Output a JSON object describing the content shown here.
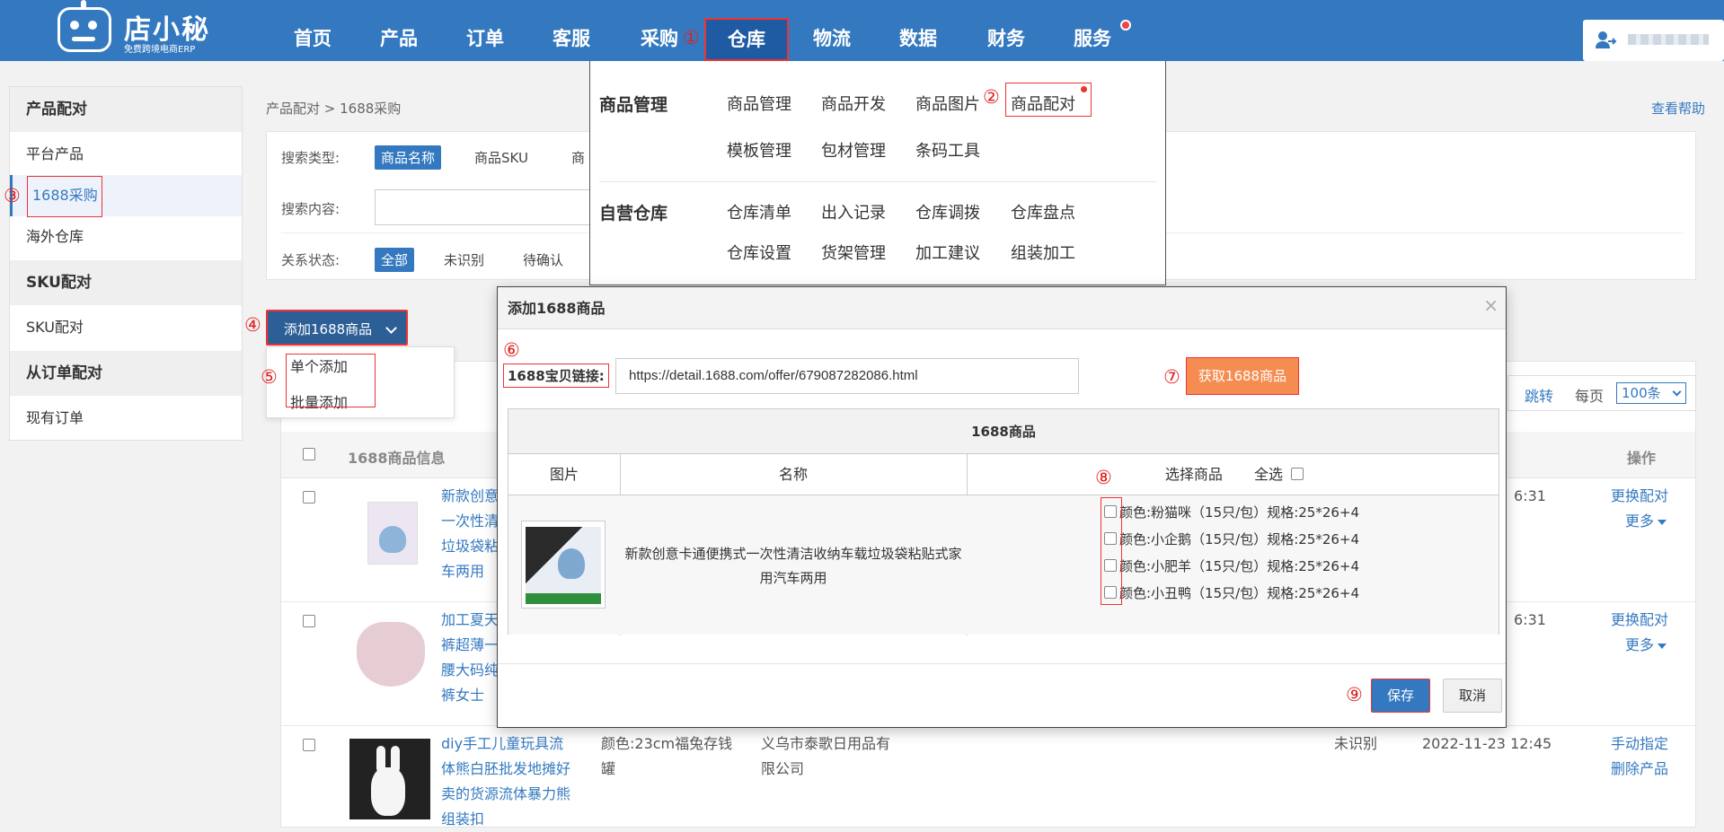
{
  "header": {
    "logo_name": "店小秘",
    "logo_sub": "免费跨境电商ERP",
    "nav": [
      "首页",
      "产品",
      "订单",
      "客服",
      "采购",
      "仓库",
      "物流",
      "数据",
      "财务",
      "服务"
    ],
    "active_nav": "仓库"
  },
  "annotations": [
    "①",
    "②",
    "③",
    "④",
    "⑤",
    "⑥",
    "⑦",
    "⑧",
    "⑨"
  ],
  "sidebar": {
    "sections": [
      {
        "title": "产品配对",
        "items": [
          "平台产品",
          "1688采购",
          "海外仓库"
        ]
      },
      {
        "title": "SKU配对",
        "items": [
          "SKU配对"
        ]
      },
      {
        "title": "从订单配对",
        "items": [
          "现有订单"
        ]
      }
    ],
    "active_item": "1688采购"
  },
  "breadcrumb": "产品配对 > 1688采购",
  "help_link": "查看帮助",
  "filter": {
    "search_type_label": "搜索类型:",
    "search_types": [
      "商品名称",
      "商品SKU",
      "商"
    ],
    "search_content_label": "搜索内容:",
    "status_label": "关系状态:",
    "statuses": [
      "全部",
      "未识别",
      "待确认"
    ]
  },
  "add_button": "添加1688商品",
  "add_menu": [
    "单个添加",
    "批量添加"
  ],
  "table": {
    "col_info": "1688商品信息",
    "col_action": "操作",
    "pager": {
      "jump": "跳转",
      "per_page": "每页",
      "per_page_value": "100条"
    },
    "rows": [
      {
        "title_lines": [
          "新款创意",
          "一次性清",
          "垃圾袋粘",
          "车两用"
        ],
        "time": "6:31",
        "actions": [
          "更换配对",
          "更多"
        ]
      },
      {
        "title_lines": [
          "加工夏天",
          "裤超薄一",
          "腰大码纯",
          "裤女士"
        ],
        "time": "6:31",
        "actions": [
          "更换配对",
          "更多"
        ]
      },
      {
        "title_lines": [
          "diy手工儿童玩具流",
          "体熊白胚批发地摊好",
          "卖的货源流体暴力熊",
          "组装扣"
        ],
        "spec_lines": [
          "颜色:23cm福兔存钱",
          "罐"
        ],
        "supplier_lines": [
          "义乌市泰歌日用品有",
          "限公司"
        ],
        "status": "未识别",
        "time": "2022-11-23 12:45",
        "actions": [
          "手动指定",
          "删除产品"
        ]
      }
    ]
  },
  "mega_menu": {
    "sections": [
      {
        "title": "商品管理",
        "items": [
          "商品管理",
          "商品开发",
          "商品图片",
          "商品配对",
          "模板管理",
          "包材管理",
          "条码工具"
        ]
      },
      {
        "title": "自营仓库",
        "items": [
          "仓库清单",
          "出入记录",
          "仓库调拨",
          "仓库盘点",
          "仓库设置",
          "货架管理",
          "加工建议",
          "组装加工"
        ]
      }
    ]
  },
  "modal": {
    "title": "添加1688商品",
    "close": "×",
    "link_label": "1688宝贝链接:",
    "link_value": "https://detail.1688.com/offer/679087282086.html",
    "fetch_button": "获取1688商品",
    "table_caption": "1688商品",
    "col_image": "图片",
    "col_name": "名称",
    "col_select": "选择商品",
    "select_all": "全选",
    "product_name": "新款创意卡通便携式一次性清洁收纳车载垃圾袋粘贴式家用汽车两用",
    "options": [
      "颜色:粉猫咪（15只/包）规格:25*26+4",
      "颜色:小企鹅（15只/包）规格:25*26+4",
      "颜色:小肥羊（15只/包）规格:25*26+4",
      "颜色:小丑鸭（15只/包）规格:25*26+4"
    ],
    "save": "保存",
    "cancel": "取消"
  },
  "colors": {
    "brand": "#3479c0",
    "active_nav": "#1e5ba3",
    "fetch": "#f58d52",
    "annotation": "#e02020"
  }
}
